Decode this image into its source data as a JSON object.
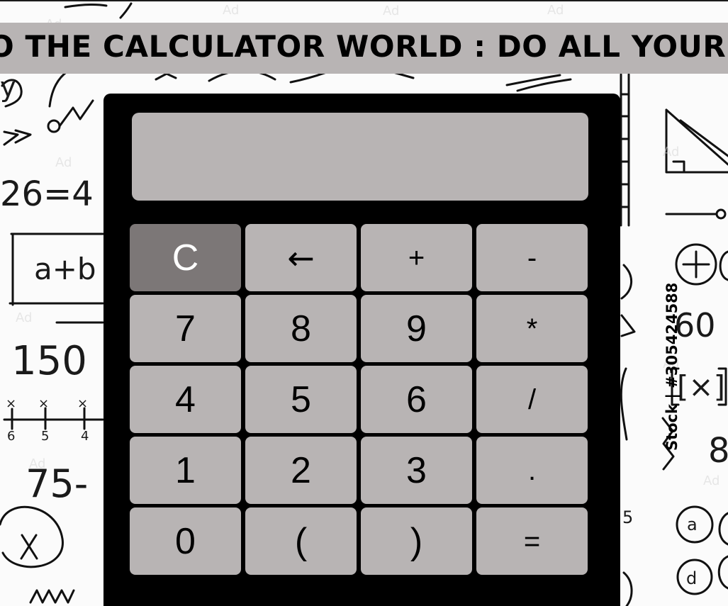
{
  "banner": {
    "text": "O THE CALCULATOR WORLD : DO ALL YOUR BA"
  },
  "calculator": {
    "display_value": "",
    "keys": {
      "clear": "C",
      "backspace": "←",
      "plus": "+",
      "minus": "-",
      "seven": "7",
      "eight": "8",
      "nine": "9",
      "multiply": "*",
      "four": "4",
      "five": "5",
      "six": "6",
      "divide": "/",
      "one": "1",
      "two": "2",
      "three": "3",
      "decimal": ".",
      "zero": "0",
      "open_paren": "(",
      "close_paren": ")",
      "equals": "="
    },
    "colors": {
      "panel": "#000000",
      "display": "#b8b4b4",
      "button": "#b8b4b4",
      "clear_button": "#7c7777",
      "clear_text": "#ffffff"
    }
  },
  "background": {
    "side_credit": "Stock | #305424588",
    "snippets": {
      "equation": "26=4",
      "expression": "a+b",
      "number_150": "150",
      "number_75": "75-",
      "number_60": "60",
      "bracket_x": "[×]",
      "number_8": "8",
      "number_5": "5",
      "letter_a": "a",
      "letter_d": "d",
      "letter_y": "y"
    }
  }
}
